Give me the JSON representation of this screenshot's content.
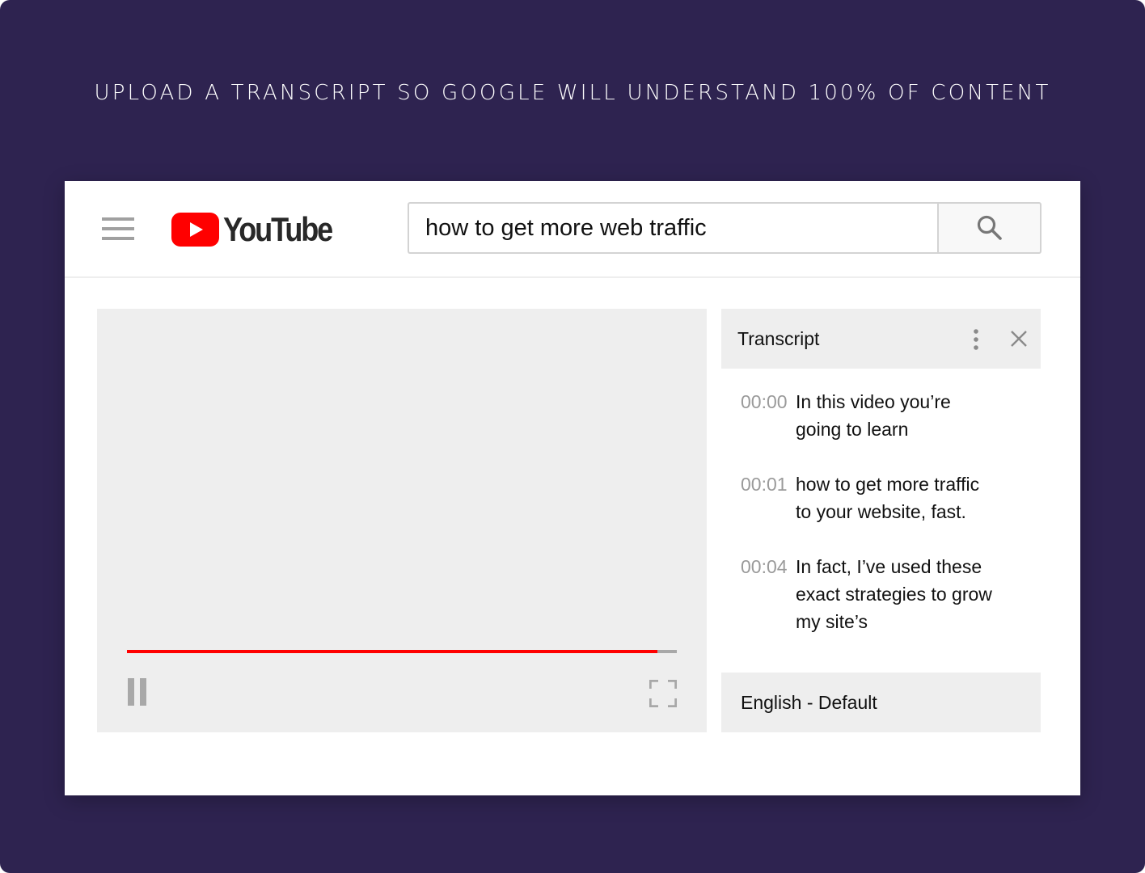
{
  "headline": "UPLOAD A TRANSCRIPT SO GOOGLE WILL UNDERSTAND 100% OF CONTENT",
  "app": {
    "brand": "YouTube",
    "brand_color": "#ff0000",
    "menu_icon": "hamburger-menu-icon",
    "logo_icon": "youtube-play-icon"
  },
  "search": {
    "value": "how to get more web traffic",
    "placeholder": "Search",
    "button_icon": "search-icon"
  },
  "player": {
    "progress": 0.965,
    "progress_color": "#ff0000",
    "controls": {
      "play_state_icon": "pause-icon",
      "fullscreen_icon": "fullscreen-icon"
    }
  },
  "transcript": {
    "title": "Transcript",
    "more_icon": "more-vertical-icon",
    "close_icon": "close-icon",
    "entries": [
      {
        "time": "00:00",
        "text": "In this video you’re going to learn"
      },
      {
        "time": "00:01",
        "text": "how to get more traffic to your website, fast."
      },
      {
        "time": "00:04",
        "text": "In fact, I’ve used these exact strategies to grow my site’s"
      }
    ],
    "language": "English - Default"
  }
}
